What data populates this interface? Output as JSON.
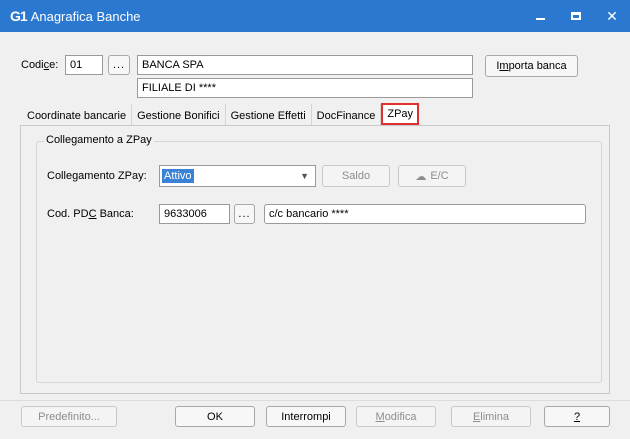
{
  "window": {
    "logo": "G1",
    "title": "Anagrafica Banche"
  },
  "header": {
    "codice_label_pre": "Codi",
    "codice_label_u": "c",
    "codice_label_post": "e:",
    "codice_value": "01",
    "ellipsis": "...",
    "bank_name": "BANCA SPA",
    "branch_name": "FILIALE DI ****",
    "import_pre": "I",
    "import_u": "m",
    "import_post": "porta banca"
  },
  "tabs": [
    {
      "label": "Coordinate bancarie"
    },
    {
      "label": "Gestione Bonifici"
    },
    {
      "label": "Gestione Effetti"
    },
    {
      "label": "DocFinance"
    },
    {
      "label": "ZPay"
    }
  ],
  "zpay": {
    "group_title": "Collegamento a ZPay",
    "collegamento_label": "Collegamento ZPay:",
    "collegamento_value": "Attivo",
    "saldo_label": "Saldo",
    "ec_label": "E/C",
    "pdc_label_pre": "Cod. PD",
    "pdc_label_u": "C",
    "pdc_label_post": " Banca:",
    "pdc_value": "9633006",
    "pdc_ellipsis": "...",
    "pdc_description": "c/c bancario ****"
  },
  "footer": {
    "predefinito": "Predefinito...",
    "ok": "OK",
    "interrompi": "Interrompi",
    "modifica_u": "M",
    "modifica_rest": "odifica",
    "elimina_u": "E",
    "elimina_rest": "limina",
    "help": "?"
  },
  "colors": {
    "titlebar": "#2b78d0",
    "active_tab_border": "#e03030",
    "selection": "#3a82d6"
  }
}
